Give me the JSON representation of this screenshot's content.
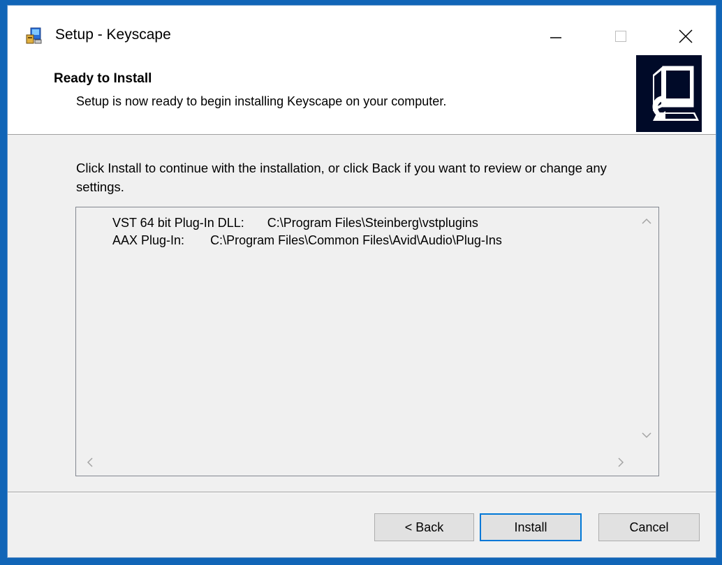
{
  "window": {
    "title": "Setup - Keyscape",
    "controls": [
      "minimize",
      "maximize",
      "close"
    ]
  },
  "header": {
    "title": "Ready to Install",
    "subtitle": "Setup is now ready to begin installing Keyscape on your computer."
  },
  "main": {
    "instruction": "Click Install to continue with the installation, or click Back if you want to review or change any settings.",
    "summary": [
      {
        "label": "VST 64 bit Plug-In DLL:",
        "path": "C:\\Program Files\\Steinberg\\vstplugins"
      },
      {
        "label": "AAX Plug-In:",
        "path": "C:\\Program Files\\Common Files\\Avid\\Audio\\Plug-Ins"
      }
    ]
  },
  "buttons": {
    "back": "< Back",
    "install": "Install",
    "cancel": "Cancel"
  },
  "colors": {
    "desktop": "#1165b7",
    "dialog_bg": "#f0f0f0",
    "default_button_border": "#0078d7"
  }
}
